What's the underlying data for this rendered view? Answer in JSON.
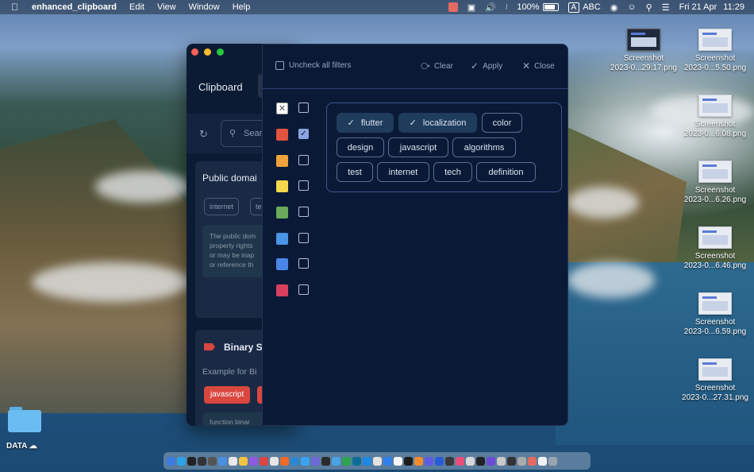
{
  "menubar": {
    "app_name": "enhanced_clipboard",
    "menus": [
      "Edit",
      "View",
      "Window",
      "Help"
    ],
    "battery_label": "100%",
    "input_label": "A",
    "input_source": "ABC",
    "date": "Fri 21 Apr",
    "time": "11:29"
  },
  "desktop": {
    "files": [
      {
        "name": "Screenshot",
        "sub": "2023-0...29.17.png"
      },
      {
        "name": "Screenshot",
        "sub": "2023-0...5.50.png"
      },
      {
        "name": "Screenshot",
        "sub": "2023-0...6.08.png"
      },
      {
        "name": "Screenshot",
        "sub": "2023-0...6.26.png"
      },
      {
        "name": "Screenshot",
        "sub": "2023-0...6.46.png"
      },
      {
        "name": "Screenshot",
        "sub": "2023-0...6.59.png"
      },
      {
        "name": "Screenshot",
        "sub": "2023-0...27.31.png"
      }
    ],
    "folder": "DATA"
  },
  "main_window": {
    "title": "Clipboard",
    "search_placeholder": "Sear",
    "card1": {
      "title": "Public domai",
      "pills": [
        "internet",
        "te"
      ],
      "body_lines": [
        "The public dom",
        "property rights",
        "or may be inap",
        "or reference th"
      ]
    },
    "card2": {
      "title": "Binary S",
      "subtitle": "Example for Bi",
      "tags": [
        "javascript"
      ],
      "body": "function binar"
    }
  },
  "filter_panel": {
    "uncheck_all": "Uncheck all filters",
    "clear": "Clear",
    "apply": "Apply",
    "close": "Close",
    "colors": [
      {
        "color": "none",
        "checked": false
      },
      {
        "color": "#e0533e",
        "checked": true
      },
      {
        "color": "#f0a23a",
        "checked": false
      },
      {
        "color": "#f5d94d",
        "checked": false
      },
      {
        "color": "#6aaa5a",
        "checked": false
      },
      {
        "color": "#4a96e6",
        "checked": false
      },
      {
        "color": "#4a86e8",
        "checked": false
      },
      {
        "color": "#d8405e",
        "checked": false
      }
    ],
    "tags": [
      {
        "label": "flutter",
        "selected": true
      },
      {
        "label": "localization",
        "selected": true
      },
      {
        "label": "color",
        "selected": false
      },
      {
        "label": "design",
        "selected": false
      },
      {
        "label": "javascript",
        "selected": false
      },
      {
        "label": "algorithms",
        "selected": false
      },
      {
        "label": "test",
        "selected": false
      },
      {
        "label": "internet",
        "selected": false
      },
      {
        "label": "tech",
        "selected": false
      },
      {
        "label": "definition",
        "selected": false
      }
    ]
  }
}
